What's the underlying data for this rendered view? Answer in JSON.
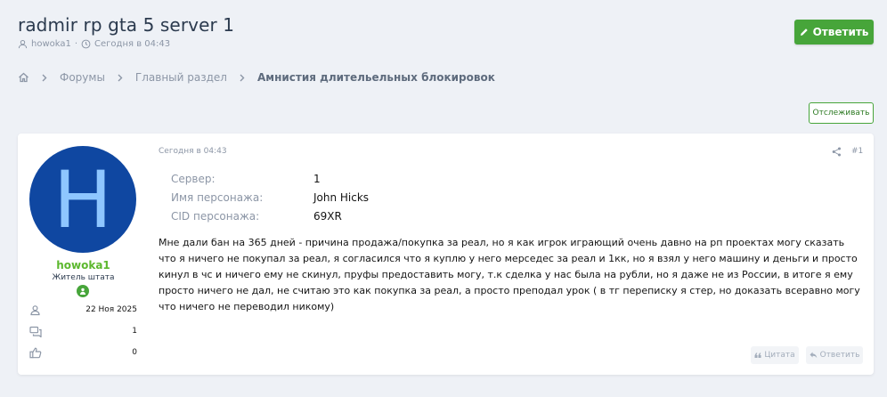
{
  "thread": {
    "title": "radmir rp gta 5 server 1",
    "author": "howoka1",
    "sep": "·",
    "time": "Сегодня в 04:43"
  },
  "header": {
    "reply_label": "Ответить"
  },
  "breadcrumbs": {
    "items": [
      "Форумы",
      "Главный раздел"
    ],
    "current": "Амнистия длительельных блокировок"
  },
  "watch_label": "Отслеживать",
  "post": {
    "date": "Сегодня в 04:43",
    "number": "#1",
    "user": {
      "name": "howoka1",
      "title": "Житель штата",
      "joined": "22 Ноя 2025",
      "messages": "1",
      "reactions": "0",
      "avatar_letter": "H",
      "avatar_color": "#0f47a1"
    },
    "fields": [
      {
        "label": "Сервер:",
        "value": "1"
      },
      {
        "label": "Имя персонажа:",
        "value": "John Hicks"
      },
      {
        "label": "CID персонажа:",
        "value": "69XR"
      }
    ],
    "message": "Мне дали бан на 365 дней - причина продажа/покупка за реал, но я как игрок играющий очень давно на рп проектах могу сказать что я ничего не покупал за реал, я согласился что я куплю у него мерседес за реал и 1кк, но я взял у него машину и деньги и просто кинул в чс и ничего ему не скинул, пруфы предоставить могу, т.к сделка у нас была на рубли, но я даже не из России, в итоге я ему просто ничего не дал, не считаю это как покупка за реал, а просто преподал урок ( в тг переписку я стер, но доказать всеравно могу что ничего не переводил никому)",
    "quote_label": "Цитата",
    "reply_label": "Ответить"
  },
  "colors": {
    "accent_green": "#47a53a",
    "username_green": "#5cb82e",
    "muted": "#8c96a6",
    "background": "#eef1f6"
  }
}
